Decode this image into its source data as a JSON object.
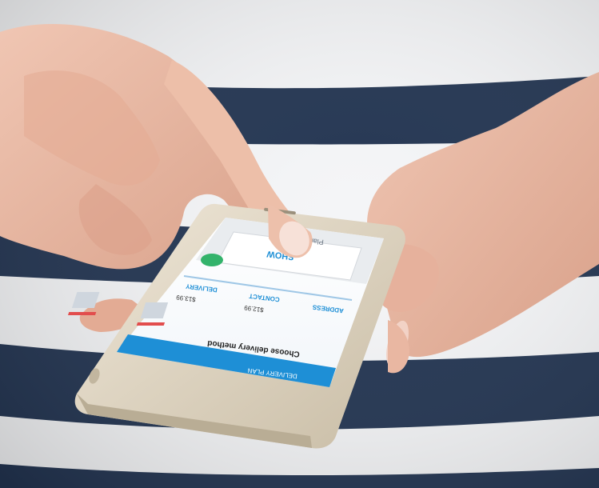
{
  "photo": {
    "subject": "hands-using-smartphone",
    "colors": {
      "navy_stripe": "#233552",
      "white_stripe": "#f4f5f7",
      "skin": "#e8b9a3",
      "phone_frame": "#d8cdb8",
      "screen_blue": "#1e8fd6"
    }
  },
  "screen": {
    "header_title": "Place your order",
    "header_brand": "SHOW",
    "header_button_label": "",
    "tabs": [
      "DELIVERY",
      "ADDRESS",
      "CONTACT"
    ],
    "item_price_left": "$13.99",
    "item_price_right": "$12.99",
    "section_title": "Choose delivery method",
    "footer_label": "DELIVERY PLAN"
  }
}
